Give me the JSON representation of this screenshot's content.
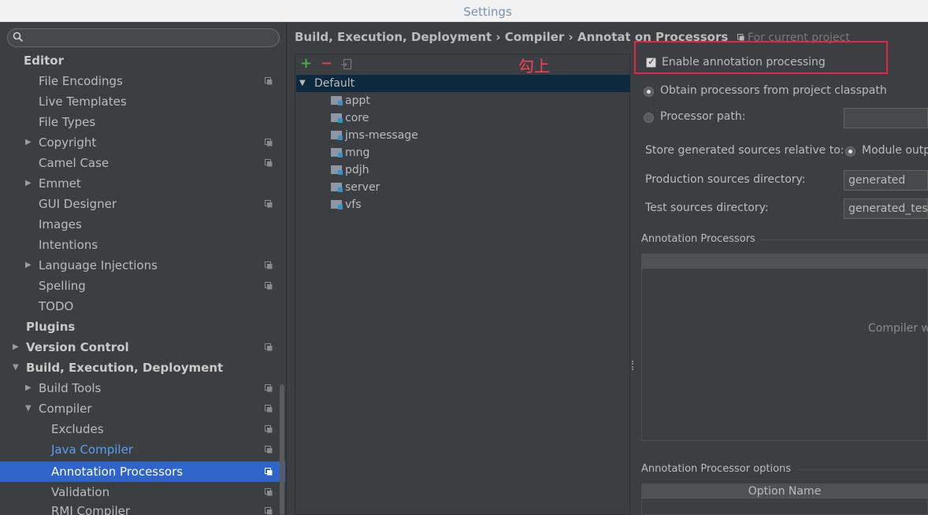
{
  "window": {
    "title": "Settings"
  },
  "search": {
    "placeholder": ""
  },
  "sidebar": {
    "items": [
      {
        "label": "Editor",
        "bold": true
      },
      {
        "label": "File Encodings"
      },
      {
        "label": "Live Templates"
      },
      {
        "label": "File Types"
      },
      {
        "label": "Copyright"
      },
      {
        "label": "Camel Case"
      },
      {
        "label": "Emmet"
      },
      {
        "label": "GUI Designer"
      },
      {
        "label": "Images"
      },
      {
        "label": "Intentions"
      },
      {
        "label": "Language Injections"
      },
      {
        "label": "Spelling"
      },
      {
        "label": "TODO"
      },
      {
        "label": "Plugins",
        "bold": true
      },
      {
        "label": "Version Control",
        "bold": true
      },
      {
        "label": "Build, Execution, Deployment",
        "bold": true
      },
      {
        "label": "Build Tools"
      },
      {
        "label": "Compiler"
      },
      {
        "label": "Excludes"
      },
      {
        "label": "Java Compiler"
      },
      {
        "label": "Annotation Processors",
        "selected": true
      },
      {
        "label": "Validation"
      },
      {
        "label": "RMI Compiler"
      }
    ]
  },
  "breadcrumb": {
    "path": "Build, Execution, Deployment › Compiler › Annotation Processors",
    "scope": "For current project"
  },
  "profiles": {
    "toolbar": {
      "add": "+",
      "remove": "−",
      "move": "move-to-icon"
    },
    "default_label": "Default",
    "modules": [
      "appt",
      "core",
      "jms-message",
      "mng",
      "pdjh",
      "server",
      "vfs"
    ]
  },
  "annotation_note": "勾上",
  "settings": {
    "enable_label": "Enable annotation processing",
    "obtain_label": "Obtain processors from project classpath",
    "processor_path_label": "Processor path:",
    "processor_path_value": "",
    "store_label": "Store generated sources relative to:",
    "store_option": "Module outp",
    "prod_dir_label": "Production sources directory:",
    "prod_dir_value": "generated",
    "test_dir_label": "Test sources directory:",
    "test_dir_value": "generated_test",
    "processors_section": "Annotation Processors",
    "processors_empty": "Compiler w",
    "options_section": "Annotation Processor options",
    "option_name_col": "Option Name"
  },
  "colors": {
    "accent": "#2f65ca",
    "highlight": "#e0264a",
    "note": "#ff3c5a"
  }
}
